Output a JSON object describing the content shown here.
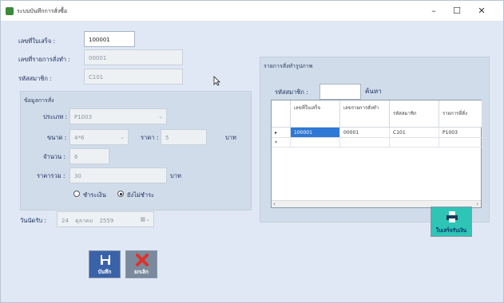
{
  "window": {
    "title": "ระบบบันทึกการสั่งซื้อ",
    "minimize": "–",
    "maximize": "☐",
    "close": "✕"
  },
  "form": {
    "invoice_label": "เลขที่ใบเสร็จ :",
    "invoice_value": "100001",
    "order_label": "เลขที่รายการสั่งทำ :",
    "order_value": "00001",
    "member_label": "รหัสสมาชิก :",
    "member_value": "C101"
  },
  "order_panel": {
    "title": "ข้อมูลการสั่ง",
    "type_label": "ประเภท :",
    "type_value": "P1003",
    "size_label": "ขนาด :",
    "size_value": "4*6",
    "price_label": "ราคา :",
    "price_value": "5",
    "price_unit": "บาท",
    "qty_label": "จำนวน :",
    "qty_value": "6",
    "total_label": "ราคารวม :",
    "total_value": "30",
    "total_unit": "บาท",
    "radio_paid": "ชำระเงิน",
    "radio_unpaid": "ยังไม่ชำระ"
  },
  "pickup": {
    "label": "วันนัดรับ :",
    "day": "24",
    "month": "ตุลาคม",
    "year": "2559"
  },
  "list_panel": {
    "title": "รายการสั่งทำรูปภาพ",
    "search_label": "รหัสสมาชิก :",
    "search_value": "",
    "search_button": "ค้นหา",
    "headers": [
      "เลขที่ใบเสร็จ",
      "เลขรายการสั่งทำ",
      "รหัสสมาชิก",
      "รายการที่สั่ง"
    ],
    "rows": [
      [
        "100001",
        "00001",
        "C101",
        "P1003"
      ]
    ],
    "row_marker": "▸",
    "new_row_marker": "*"
  },
  "buttons": {
    "receipt": "ใบเสร็จรับเงิน",
    "save": "บันทึก",
    "cancel": "ยกเลิก"
  },
  "colors": {
    "receipt_btn": "#2ec4b6",
    "save_btn": "#3a62a8",
    "cancel_btn": "#7a8a9c"
  }
}
